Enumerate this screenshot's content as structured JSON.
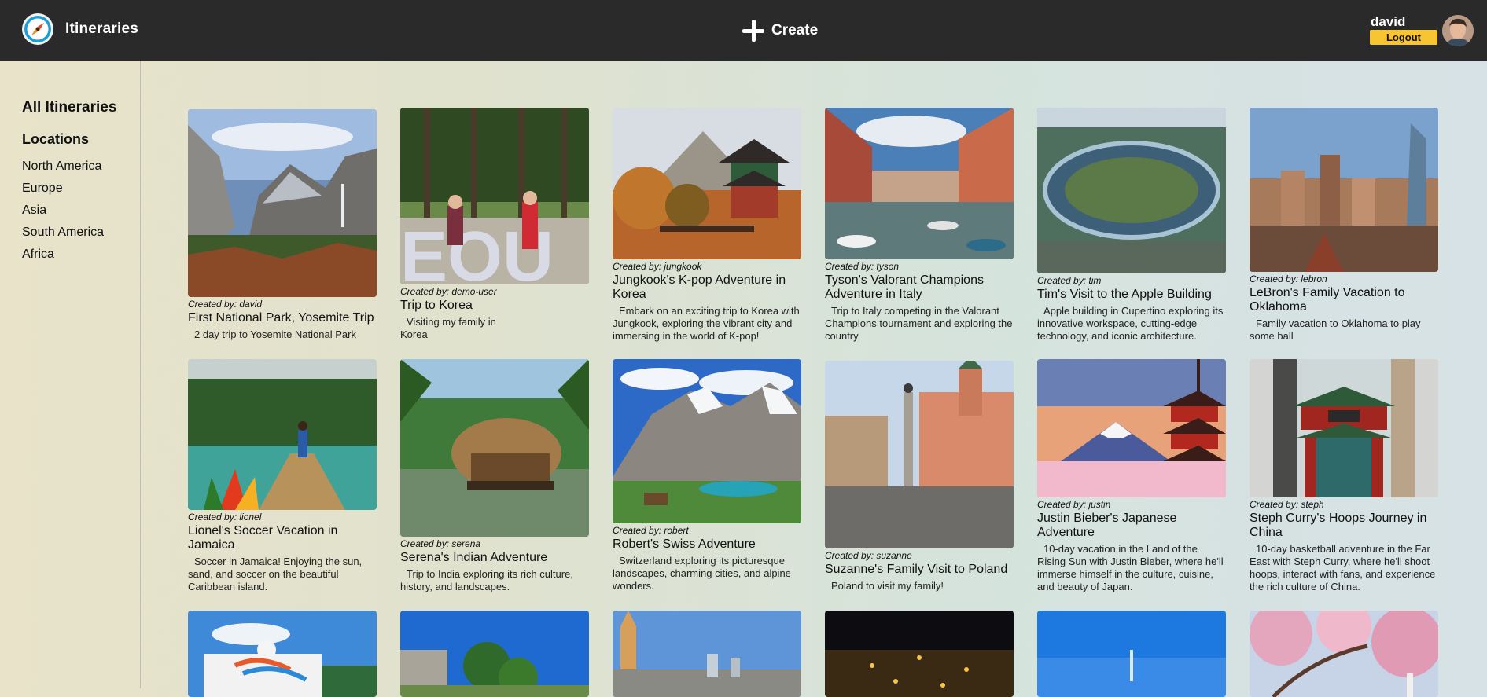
{
  "header": {
    "app_title": "Itineraries",
    "create_label": "Create",
    "user_name": "david",
    "logout_label": "Logout"
  },
  "sidebar": {
    "all_label": "All Itineraries",
    "locations_heading": "Locations",
    "items": [
      "North America",
      "Europe",
      "Asia",
      "South America",
      "Africa"
    ]
  },
  "cards": [
    {
      "created_by": "Created by: david",
      "title": "First National Park, Yosemite Trip",
      "description": "2 day trip to Yosemite National Park",
      "image": "yosemite-valley-photo"
    },
    {
      "created_by": "Created by: demo-user",
      "title": "Trip to Korea",
      "description": "Visiting my family in Korea",
      "image": "korea-park-photo"
    },
    {
      "created_by": "Created by: jungkook",
      "title": "Jungkook's K-pop Adventure in Korea",
      "description": "Embark on an exciting trip to Korea with Jungkook, exploring the vibrant city and immersing in the world of K-pop!",
      "image": "korean-pavilion-photo"
    },
    {
      "created_by": "Created by: tyson",
      "title": "Tyson's Valorant Champions Adventure in Italy",
      "description": "Trip to Italy competing in the Valorant Champions tournament and exploring the country",
      "image": "venice-canal-photo"
    },
    {
      "created_by": "Created by: tim",
      "title": "Tim's Visit to the Apple Building",
      "description": "Apple building in Cupertino exploring its innovative workspace, cutting-edge technology, and iconic architecture.",
      "image": "apple-park-photo"
    },
    {
      "created_by": "Created by: lebron",
      "title": "LeBron's Family Vacation to Oklahoma",
      "description": "Family vacation to Oklahoma to play some ball",
      "image": "oklahoma-city-photo"
    },
    {
      "created_by": "Created by: lionel",
      "title": "Lionel's Soccer Vacation in Jamaica",
      "description": "Soccer in Jamaica! Enjoying the sun, sand, and soccer on the beautiful Caribbean island.",
      "image": "jamaica-raft-photo"
    },
    {
      "created_by": "Created by: serena",
      "title": "Serena's Indian Adventure",
      "description": "Trip to India exploring its rich culture, history, and landscapes.",
      "image": "kerala-houseboat-photo"
    },
    {
      "created_by": "Created by: robert",
      "title": "Robert's Swiss Adventure",
      "description": "Switzerland exploring its picturesque landscapes, charming cities, and alpine wonders.",
      "image": "swiss-alps-photo"
    },
    {
      "created_by": "Created by: suzanne",
      "title": "Suzanne's Family Visit to Poland",
      "description": "Poland to visit my family!",
      "image": "warsaw-square-photo"
    },
    {
      "created_by": "Created by: justin",
      "title": "Justin Bieber's Japanese Adventure",
      "description": "10-day vacation in the Land of the Rising Sun with Justin Bieber, where he'll immerse himself in the culture, cuisine, and beauty of Japan.",
      "image": "mount-fuji-pagoda-photo"
    },
    {
      "created_by": "Created by: steph",
      "title": "Steph Curry's Hoops Journey in China",
      "description": "10-day basketball adventure in the Far East with Steph Curry, where he'll shoot hoops, interact with fans, and experience the rich culture of China.",
      "image": "chinatown-gate-photo"
    },
    {
      "image": "cruise-ship-photo"
    },
    {
      "image": "tropical-ruins-photo"
    },
    {
      "image": "colonial-city-photo"
    },
    {
      "image": "city-night-photo"
    },
    {
      "image": "blue-sky-photo"
    },
    {
      "image": "cherry-blossom-photo"
    }
  ]
}
